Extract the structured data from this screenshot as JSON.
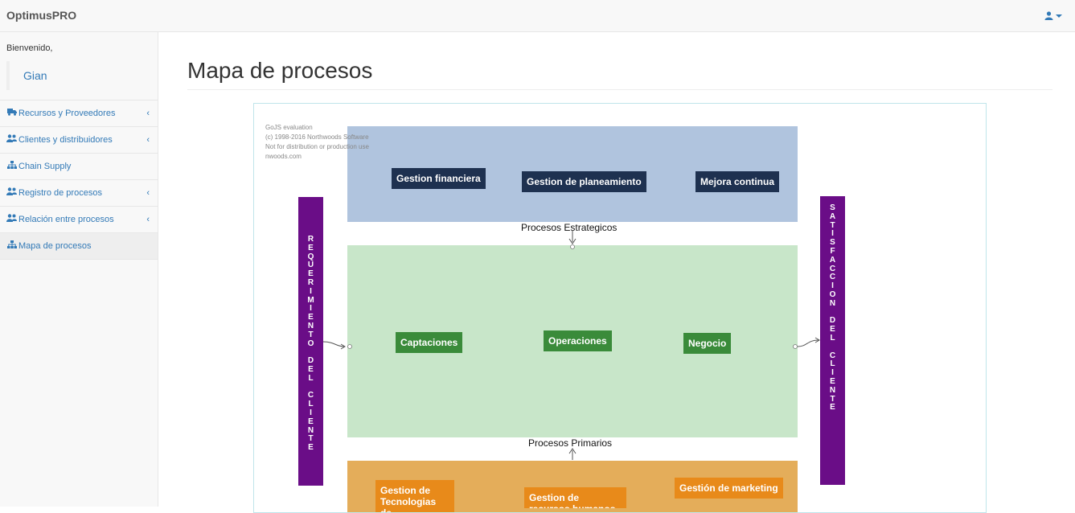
{
  "app": {
    "brand": "OptimusPRO"
  },
  "sidebar": {
    "welcome": "Bienvenido,",
    "username": "Gian",
    "items": [
      {
        "label": "Recursos y Proveedores",
        "icon": "truck-icon",
        "has_submenu": true
      },
      {
        "label": "Clientes y distribuidores",
        "icon": "users-icon",
        "has_submenu": true
      },
      {
        "label": "Chain Supply",
        "icon": "sitemap-icon",
        "has_submenu": false
      },
      {
        "label": "Registro de procesos",
        "icon": "users-icon",
        "has_submenu": true
      },
      {
        "label": "Relación entre procesos",
        "icon": "users-icon",
        "has_submenu": true
      },
      {
        "label": "Mapa de procesos",
        "icon": "sitemap-icon",
        "has_submenu": false,
        "active": true
      }
    ]
  },
  "main": {
    "title": "Mapa de procesos"
  },
  "diagram": {
    "watermark": [
      "GoJS evaluation",
      "(c) 1998-2016 Northwoods Software",
      "Not for distribution or production use",
      "nwoods.com"
    ],
    "groups": {
      "strategic": "Procesos Estrategicos",
      "primary": "Procesos Primarios"
    },
    "strategic_nodes": [
      "Gestion financiera",
      "Gestion de planeamiento",
      "Mejora continua"
    ],
    "primary_nodes": [
      "Captaciones",
      "Operaciones",
      "Negocio"
    ],
    "support_nodes": [
      "Gestion de Tecnologias de",
      "Gestion de recursos humanos",
      "Gestión de marketing"
    ],
    "left_bar": "REQUERIMIENTO DEL CLIENTE",
    "right_bar": "SATISFACCION DEL CLIENTE",
    "colors": {
      "strategic_band": "#b0c4de",
      "primary_band": "#c8e6c9",
      "support_band": "#e4ad5a",
      "strategic_node": "#1e3150",
      "primary_node": "#3a8b3a",
      "support_node": "#e88a1a",
      "side_bar": "#6a0d87"
    }
  }
}
